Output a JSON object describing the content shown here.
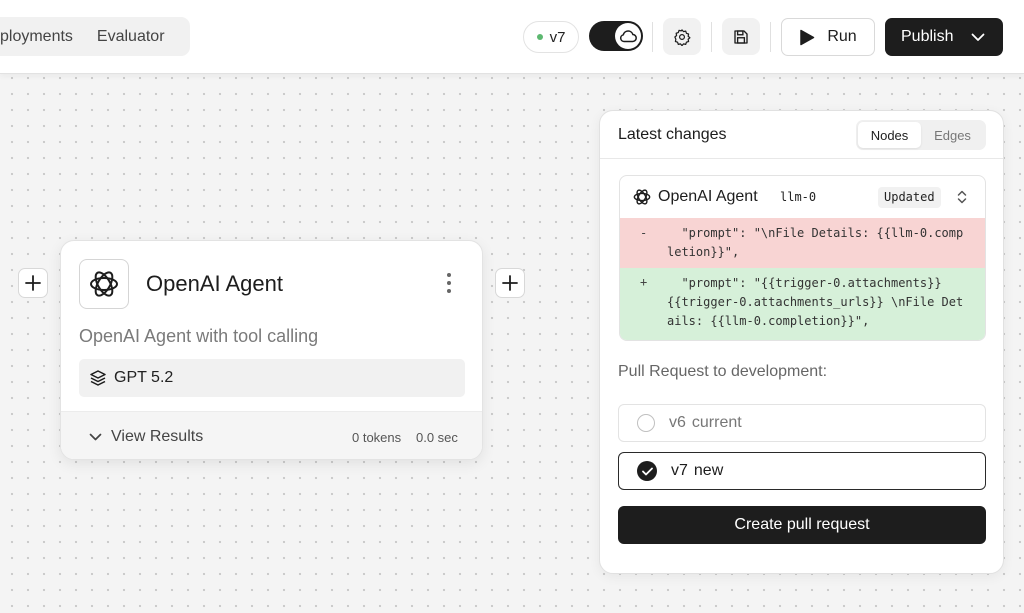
{
  "header": {
    "tabs": [
      {
        "label": "ployments"
      },
      {
        "label": "Evaluator"
      }
    ],
    "version": "v7",
    "run_label": "Run",
    "publish_label": "Publish"
  },
  "agent_node": {
    "title": "OpenAI Agent",
    "description": "OpenAI Agent with tool calling",
    "model": "GPT 5.2",
    "view_results_label": "View Results",
    "tokens": "0 tokens",
    "duration": "0.0 sec"
  },
  "changes_panel": {
    "title": "Latest changes",
    "segments": [
      {
        "label": "Nodes",
        "active": true
      },
      {
        "label": "Edges",
        "active": false
      }
    ],
    "diff": {
      "node_name": "OpenAI Agent",
      "node_id": "llm-0",
      "status": "Updated",
      "removed_sign": "-",
      "removed": "  \"prompt\": \"\\nFile Details: {{llm-0.completion}}\",",
      "added_sign": "+",
      "added": "  \"prompt\": \"{{trigger-0.attachments}} {{trigger-0.attachments_urls}} \\nFile Details: {{llm-0.completion}}\","
    },
    "pr_label": "Pull Request to development:",
    "options": [
      {
        "version": "v6",
        "tag": "current",
        "selected": false
      },
      {
        "version": "v7",
        "tag": "new",
        "selected": true
      }
    ],
    "create_pr_label": "Create pull request"
  },
  "colors": {
    "accent": "#1d1d1d",
    "status_green": "#5cb870",
    "diff_removed": "#f8d4d3",
    "diff_added": "#d6f0d9"
  },
  "icons": [
    "cloud-icon",
    "gear-icon",
    "save-icon",
    "play-icon",
    "chevron-down-icon",
    "plus-icon",
    "openai-logo-icon",
    "kebab-menu-icon",
    "layers-icon",
    "chevron-up-down-icon",
    "checkmark-icon"
  ]
}
